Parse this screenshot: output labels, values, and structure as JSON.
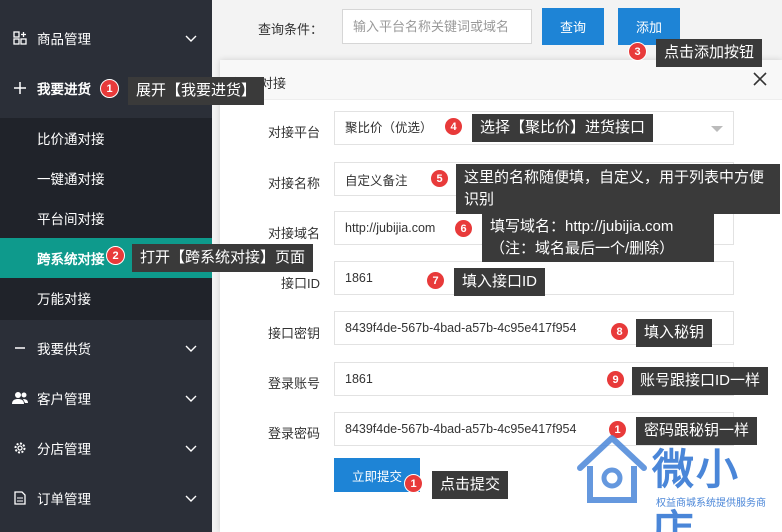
{
  "sidebar": {
    "items": [
      {
        "label": "商品管理",
        "icon": "grid-plus-icon"
      },
      {
        "label": "我要进货",
        "icon": "plus-icon"
      },
      {
        "label": "我要供货",
        "icon": "minus-icon"
      },
      {
        "label": "客户管理",
        "icon": "users-icon"
      },
      {
        "label": "分店管理",
        "icon": "gear-icon"
      },
      {
        "label": "订单管理",
        "icon": "document-icon"
      }
    ],
    "subitems": [
      "比价通对接",
      "一键通对接",
      "平台间对接",
      "跨系统对接",
      "万能对接"
    ]
  },
  "topbar": {
    "query_label": "查询条件：",
    "query_placeholder": "输入平台名称关键词或域名",
    "query_button": "查询",
    "add_button": "添加"
  },
  "modal": {
    "title": "添加对接",
    "fields": [
      {
        "label": "对接平台",
        "value": "聚比价（优选）"
      },
      {
        "label": "对接名称",
        "value": "自定义备注"
      },
      {
        "label": "对接域名",
        "value": "http://jubijia.com"
      },
      {
        "label": "接口ID",
        "value": "1861"
      },
      {
        "label": "接口密钥",
        "value": "8439f4de-567b-4bad-a57b-4c95e417f954"
      },
      {
        "label": "登录账号",
        "value": "1861"
      },
      {
        "label": "登录密码",
        "value": "8439f4de-567b-4bad-a57b-4c95e417f954"
      }
    ],
    "submit": "立即提交"
  },
  "annotations": {
    "b1": "1",
    "t1": "展开【我要进货】",
    "b2": "2",
    "t2": "打开【跨系统对接】页面",
    "b3": "3",
    "t3": "点击添加按钮",
    "b4": "4",
    "t4": "选择【聚比价】进货接口",
    "b5": "5",
    "t5": "这里的名称随便填，自定义，用于列表中方便识别",
    "b6": "6",
    "t6a": "填写域名：http://jubijia.com",
    "t6b": "（注：域名最后一个/删除）",
    "b7": "7",
    "t7": "填入接口ID",
    "b8": "8",
    "t8": "填入秘钥",
    "b9": "9",
    "t9": "账号跟接口ID一样",
    "b10": "1",
    "t10": "密码跟秘钥一样",
    "b11": "1",
    "t11": "点击提交"
  },
  "watermark": {
    "brand": "微小店",
    "slogan": "权益商城系统提供服务商"
  },
  "colors": {
    "sidebar_bg": "#2b2f38",
    "active_teal": "#0e9a8c",
    "primary_blue": "#1e84d6",
    "badge_red": "#e83a3a"
  }
}
